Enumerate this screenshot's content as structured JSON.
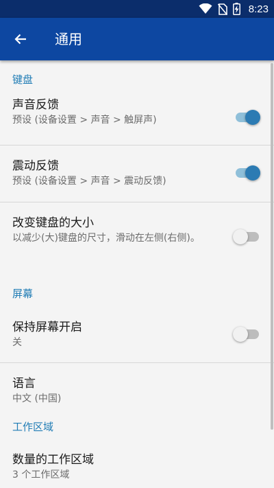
{
  "status_bar": {
    "time": "8:23",
    "icons": [
      "wifi-icon",
      "no-sim-icon",
      "battery-charging-icon"
    ]
  },
  "app_bar": {
    "title": "通用",
    "back_icon": "arrow-back-icon"
  },
  "sections": {
    "keyboard": {
      "header": "键盘"
    },
    "screen": {
      "header": "屏幕"
    },
    "workspace": {
      "header": "工作区域"
    }
  },
  "settings": {
    "sound_feedback": {
      "title": "声音反馈",
      "summary": "预设 (设备设置 > 声音 > 触屏声)",
      "enabled": true
    },
    "vibration_feedback": {
      "title": "震动反馈",
      "summary": "预设 (设备设置 > 声音 > 震动反馈)",
      "enabled": true
    },
    "keyboard_size": {
      "title": "改变键盘的大小",
      "summary": "以减少(大)键盘的尺寸，滑动在左侧(右侧)。",
      "enabled": false
    },
    "keep_screen_on": {
      "title": "保持屏幕开启",
      "summary": "关",
      "enabled": false
    },
    "language": {
      "title": "语言",
      "summary": "中文 (中国)"
    },
    "workspace_count": {
      "title": "数量的工作区域",
      "summary": "3 个工作区域"
    }
  },
  "colors": {
    "status_bar": "#0b2d6b",
    "app_bar": "#0d47a1",
    "section_header": "#1f7cb5",
    "switch_on_thumb": "#2c7bb3",
    "switch_on_track": "#8fbfd9"
  }
}
